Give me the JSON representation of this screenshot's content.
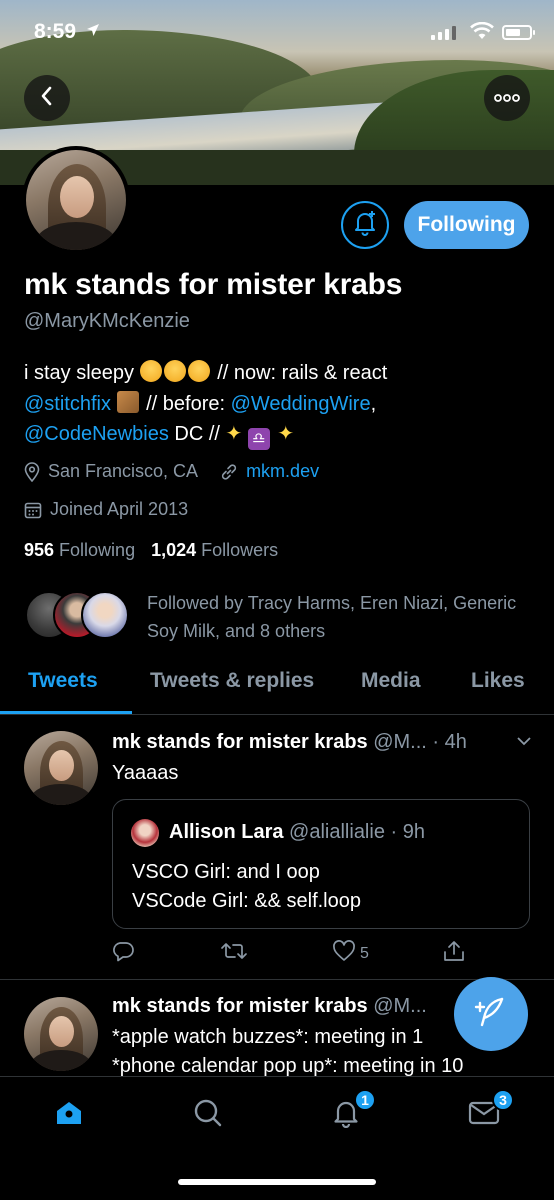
{
  "status_bar": {
    "time": "8:59"
  },
  "profile": {
    "display_name": "mk stands for mister krabs",
    "handle": "@MaryKMcKenzie",
    "follow_button_label": "Following",
    "bio": {
      "line1_text": "i stay sleepy",
      "line1_tail": "// now: rails & react",
      "link_stitchfix": "@stitchfix",
      "before_text": "// before:",
      "link_weddingwire": "@WeddingWire",
      "comma": ",",
      "link_codenewbies": "@CodeNewbies",
      "dc_text": "DC //"
    },
    "location": "San Francisco, CA",
    "website": "mkm.dev",
    "joined": "Joined April 2013",
    "following_count": "956",
    "following_label": "Following",
    "followers_count": "1,024",
    "followers_label": "Followers",
    "followed_by": "Followed by Tracy Harms, Eren Niazi, Generic Soy Milk, and 8 others"
  },
  "tabs": [
    {
      "label": "Tweets",
      "active": true
    },
    {
      "label": "Tweets & replies",
      "active": false
    },
    {
      "label": "Media",
      "active": false
    },
    {
      "label": "Likes",
      "active": false
    }
  ],
  "tweets": [
    {
      "name": "mk stands for mister krabs",
      "handle_time": "@M... · 4h",
      "text": "Yaaaas",
      "quote": {
        "name": "Allison Lara",
        "handle_time": "@aliallialie · 9h",
        "line1": "VSCO Girl: and I oop",
        "line2": "VSCode Girl: && self.loop"
      },
      "like_count": "5"
    },
    {
      "name": "mk stands for mister krabs",
      "handle_time": "@M...",
      "line1": "*apple watch buzzes*: meeting in 1",
      "line2": "*phone calendar pop up*: meeting in 10"
    }
  ],
  "bottom_nav": {
    "notifications_badge": "1",
    "messages_badge": "3"
  },
  "colors": {
    "accent": "#1da1f2",
    "button": "#4da3ea",
    "muted": "#8b98a5",
    "background": "#000000"
  }
}
